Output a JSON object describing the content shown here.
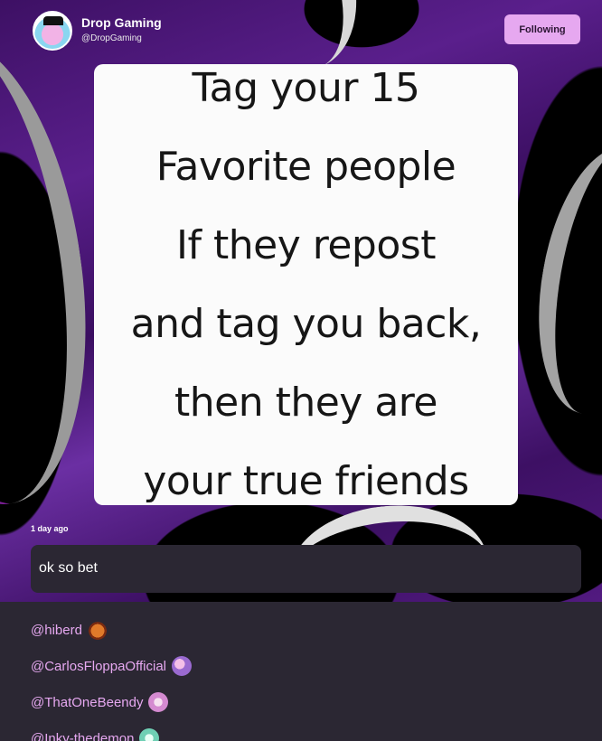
{
  "channel": {
    "name": "Drop Gaming",
    "handle": "@DropGaming",
    "follow_label": "Following"
  },
  "post": {
    "image_lines": [
      "Tag your 15",
      "Favorite people",
      "If they repost",
      "and tag you back,",
      "then they are",
      "your true friends"
    ],
    "timestamp": "1 day ago",
    "caption": "ok so bet"
  },
  "mentions": [
    {
      "handle": "@hiberd",
      "badge": "pumpkin-avatar-icon",
      "color": "#c2451b"
    },
    {
      "handle": "@CarlosFloppaOfficial",
      "badge": "user-avatar-icon",
      "color": "#b58ad6"
    },
    {
      "handle": "@ThatOneBeendy",
      "badge": "user-avatar-icon",
      "color": "#d89ad8"
    },
    {
      "handle": "@Inky-thedemon",
      "badge": "user-avatar-icon",
      "color": "#7fd6c0"
    }
  ],
  "colors": {
    "accent": "#e6a8f0",
    "background": "#2b2733",
    "banner_purple": "#5a1f8c"
  }
}
